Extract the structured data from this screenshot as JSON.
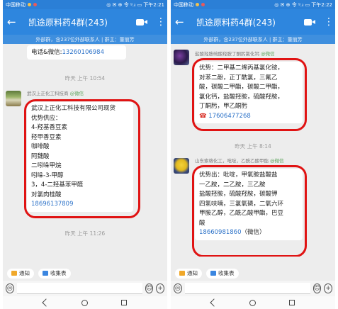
{
  "left": {
    "status": {
      "carrier": "中国移动",
      "icons": "◎ ✉ ⊕ 令 ᵍ.ᵢₗ ▭",
      "time": "下午2:21"
    },
    "header": {
      "back": "←",
      "title": "凯途原料药4群(243)",
      "more": "⋮"
    },
    "notice": "外部群，含237位外部联系人 | 群主：董丽芳",
    "top_text": "电话&微信:",
    "top_phone": "13260106984",
    "time1": "昨天 上午 10:54",
    "sender": {
      "name": "武汉上正化工科技商 ",
      "badge": "@微信"
    },
    "lines": [
      "武汉上正化工科技有限公司现货",
      "优势供应：",
      "4-羟基香豆素",
      "羟甲香豆素",
      "咖啡酸",
      "阿魏酸",
      "二吲哚甲烷",
      "吲哚-3-甲醇",
      "3，4-二羟基苯甲醛",
      "对氯肉桂酸"
    ],
    "phone": "18696137809",
    "time2": "昨天 上午 11:26"
  },
  "right": {
    "status": {
      "carrier": "中国移动",
      "icons": "◎ ✉ ⊕ 令 ᵍ.ᵢₗ ▭",
      "time": "下午2:22"
    },
    "header": {
      "back": "←",
      "title": "凯途原料药4群(243)",
      "more": "⋮"
    },
    "notice": "外部群，含237位外部联系人 | 群主：董丽芳",
    "sender1": {
      "name": "盐酸羟胺硫酸羟胺丁酮肟氯化钙 ",
      "badge": "@微信"
    },
    "lines1": [
      "优势：二甲基二烯丙基氯化铵，",
      "对苯二酚，正丁酰氯，三氟乙",
      "酸，碳酸二甲酯，碳酸二甲酯，",
      "氯化钙，盐酸羟胺，硫酸羟胺，",
      "丁酮肟，甲乙酮肟"
    ],
    "phone1_icon": "☎",
    "phone1": "17606477268",
    "time1": "昨天 上午 8:14",
    "sender2": {
      "name": "山东索格化工，吡啶，乙酰乙酸甲酯 ",
      "badge": "@微信"
    },
    "lines2": [
      "优势出：吡啶，甲氧胺盐酸盐",
      "一乙胺，二乙胺，三乙胺",
      "盐酸羟胺，硫酸羟胺，碳酸钾",
      "四氢呋喃，三氯氧磷，二氧六环",
      "甲胺乙醇，乙酰乙酸甲酯，巴豆",
      "酸"
    ],
    "phone2": "18660981860",
    "phone2_note": "（微信）"
  },
  "quickbar": {
    "notice_label": "通知",
    "form_label": "收集表"
  },
  "inputbar": {
    "voice": "◎",
    "emoji": "☺",
    "plus": "+"
  },
  "colors": {
    "header": "#2e86de",
    "status": "#2b7fd6",
    "highlight": "#e01313",
    "phone": "#2f74c9",
    "badge": "#5aa35a"
  }
}
